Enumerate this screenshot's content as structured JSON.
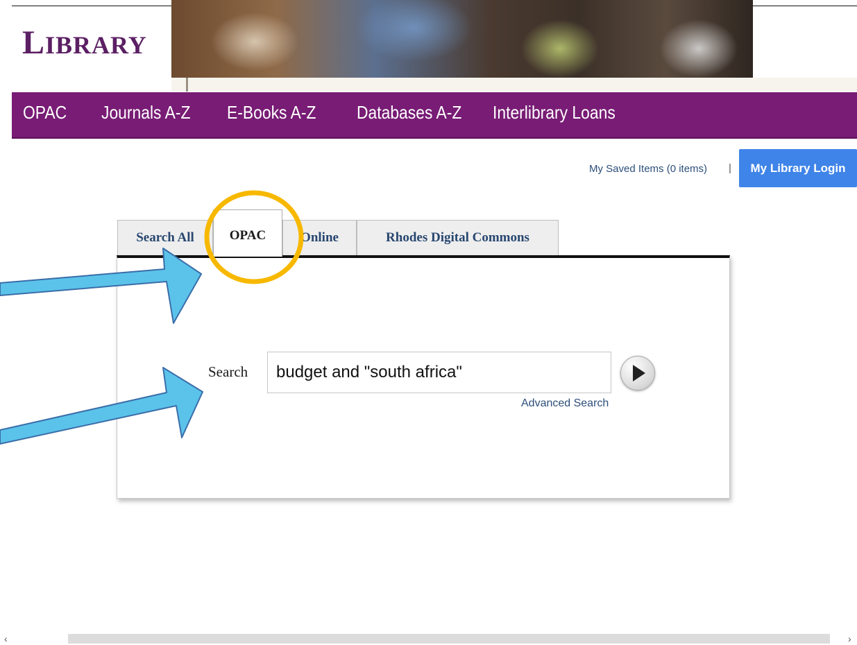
{
  "header": {
    "logo_initial": "L",
    "logo_rest": "IBRARY"
  },
  "nav": {
    "items": [
      {
        "label": "OPAC"
      },
      {
        "label": "Journals A-Z"
      },
      {
        "label": "E-Books A-Z"
      },
      {
        "label": "Databases A-Z"
      },
      {
        "label": "Interlibrary Loans"
      }
    ]
  },
  "utility": {
    "saved_items": "My Saved Items (0 items)",
    "separator": "|",
    "login": "My Library Login"
  },
  "tabs": [
    {
      "label": "Search All"
    },
    {
      "label": "OPAC",
      "active": true
    },
    {
      "label": "Online"
    },
    {
      "label": "Rhodes Digital Commons"
    }
  ],
  "search": {
    "label": "Search",
    "value": "budget and \"south africa\"",
    "advanced": "Advanced Search"
  },
  "annotations": {
    "arrow_color": "#5bc3ea",
    "highlight_color": "#f7b800"
  },
  "icons": {
    "go_button": "play-icon",
    "scroll_left": "chevron-left-icon",
    "scroll_right": "chevron-right-icon"
  }
}
